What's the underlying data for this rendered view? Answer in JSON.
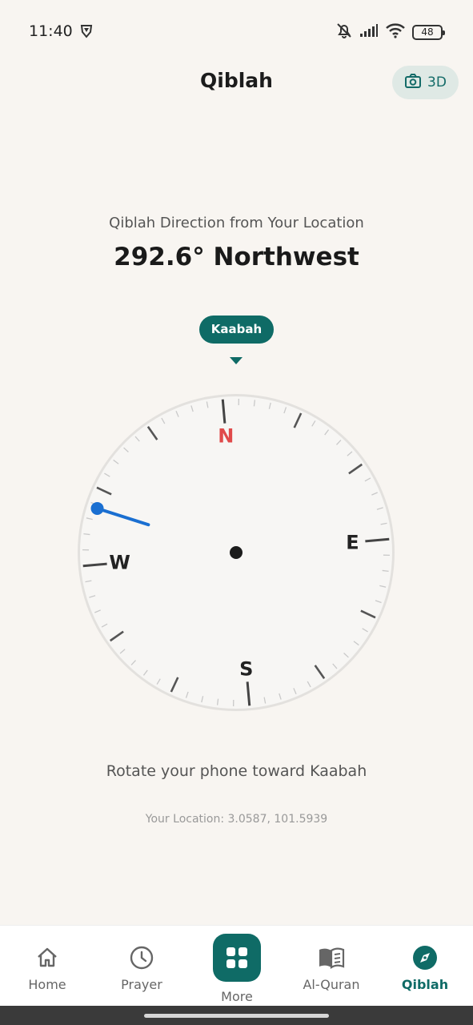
{
  "status": {
    "time": "11:40",
    "battery": "48"
  },
  "header": {
    "title": "Qiblah",
    "view_3d_label": "3D"
  },
  "qiblah": {
    "caption": "Qiblah Direction from Your Location",
    "direction": "292.6° Northwest",
    "bearing_deg": 292.6,
    "target_label": "Kaabah",
    "hint": "Rotate your phone toward Kaabah",
    "location": "Your Location: 3.0587, 101.5939"
  },
  "compass": {
    "north": "N",
    "east": "E",
    "south": "S",
    "west": "W",
    "rotation_deg": -5,
    "north_color": "#e04a4a",
    "needle_color": "#1a6fd1"
  },
  "nav": {
    "home": "Home",
    "prayer": "Prayer",
    "more": "More",
    "quran": "Al-Quran",
    "qiblah": "Qiblah",
    "accent": "#0f6b66"
  }
}
